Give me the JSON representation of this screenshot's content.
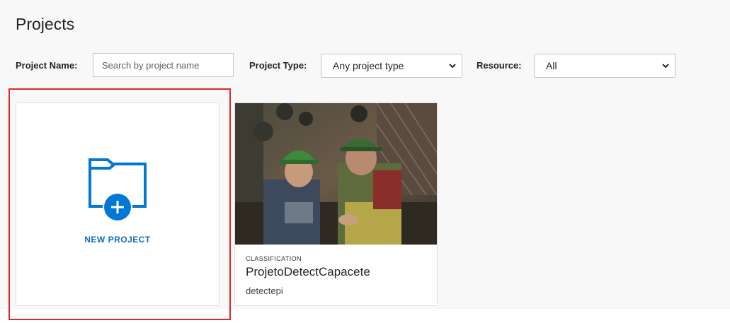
{
  "header": {
    "title": "Projects"
  },
  "filters": {
    "project_name_label": "Project Name:",
    "project_name_placeholder": "Search by project name",
    "project_name_value": "",
    "project_type_label": "Project Type:",
    "project_type_selected": "Any project type",
    "resource_label": "Resource:",
    "resource_selected": "All"
  },
  "new_project": {
    "label": "NEW PROJECT",
    "icon": "folder-plus-icon",
    "accent_color": "#0078d4"
  },
  "projects": [
    {
      "type": "CLASSIFICATION",
      "name": "ProjetoDetectCapacete",
      "resource": "detectepi",
      "thumbnail": "two workers wearing green hard hats"
    }
  ],
  "highlight_color": "#e0262b"
}
